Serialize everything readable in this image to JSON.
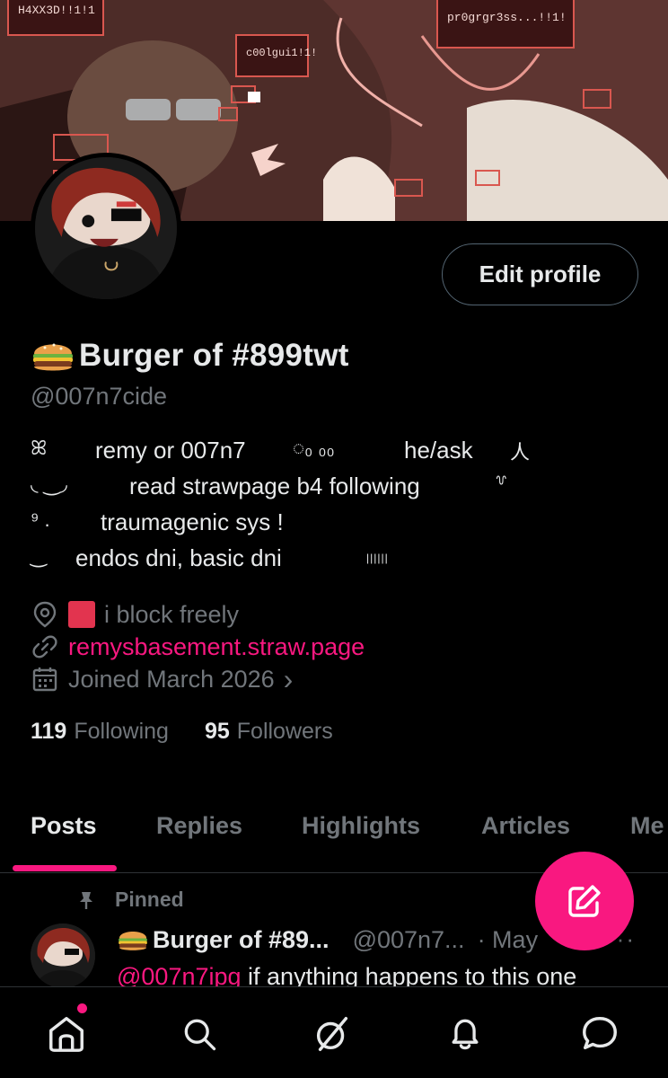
{
  "banner": {
    "labels": [
      "H4XX3D!!1!1",
      "pr0grgr3ss...!!1!",
      "c00lgui1!1!"
    ]
  },
  "profile": {
    "display_name": "Burger of #899twt",
    "name_emoji": "hamburger-icon",
    "handle": "@007n7cide",
    "edit_label": "Edit profile"
  },
  "bio": {
    "line1": {
      "lead": "ꕤ",
      "main": "remy or 007n7",
      "mid": "◌₀ ₀₀",
      "tail": "he/ask",
      "end": "人"
    },
    "line2": {
      "lead": "◟ ‿◞",
      "main": "read strawpage b4 following",
      "end": "꒷"
    },
    "line3": {
      "lead": "⁹ .",
      "main": "traumagenic sys !"
    },
    "line4": {
      "lead": "‿",
      "main": "endos dni, basic dni",
      "end": "||||||"
    }
  },
  "meta": {
    "location": "i block freely",
    "website": "remysbasement.straw.page",
    "joined": "Joined March 2026",
    "joined_chevron": "›"
  },
  "stats": {
    "following_count": "119",
    "following_label": "Following",
    "followers_count": "95",
    "followers_label": "Followers"
  },
  "tabs": [
    "Posts",
    "Replies",
    "Highlights",
    "Articles",
    "Me"
  ],
  "active_tab": "Posts",
  "pinned_post": {
    "pinned_label": "Pinned",
    "author": "Burger of #89...",
    "handle": "@007n7...",
    "date": "· May",
    "more": "···",
    "mention": "@007n7ipg",
    "text": " if anything happens to this one"
  },
  "colors": {
    "accent": "#f91880",
    "background": "#000000",
    "text_primary": "#e7e9ea",
    "text_secondary": "#71767b",
    "border": "#2f3336"
  },
  "bottom_nav": [
    "home-icon",
    "search-icon",
    "grok-icon",
    "notifications-icon",
    "messages-icon"
  ]
}
